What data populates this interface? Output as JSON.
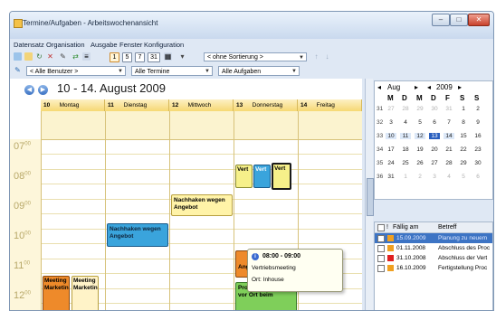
{
  "window": {
    "title": "Termine/Aufgaben - Arbeitswochenansicht",
    "controls": {
      "minimize": "–",
      "maximize": "□",
      "close": "✕"
    }
  },
  "menu": [
    "Datensatz",
    "Organisation",
    "Ausgabe",
    "Fenster",
    "Konfiguration"
  ],
  "toolbar": {
    "view_buttons": [
      "1",
      "5",
      "7",
      "31"
    ],
    "sort_value": "< ohne Sortierung >"
  },
  "filters": {
    "user": "< Alle Benutzer >",
    "appointments": "Alle Termine",
    "tasks": "Alle Aufgaben"
  },
  "calendar": {
    "week_title": "10 - 14. August 2009",
    "days": [
      {
        "num": "10",
        "name": "Montag"
      },
      {
        "num": "11",
        "name": "Dienstag"
      },
      {
        "num": "12",
        "name": "Mittwoch"
      },
      {
        "num": "13",
        "name": "Donnerstag"
      },
      {
        "num": "14",
        "name": "Freitag"
      }
    ],
    "hours": [
      {
        "h": "07",
        "m": "00"
      },
      {
        "h": "08",
        "m": "00"
      },
      {
        "h": "09",
        "m": "00"
      },
      {
        "h": "10",
        "m": "00"
      },
      {
        "h": "11",
        "m": "00"
      },
      {
        "h": "12",
        "m": "00"
      }
    ],
    "appointments": {
      "vert1": "Vert",
      "vert2": "Vert",
      "vert3": "Vert",
      "nachhaken_mi": "Nachhaken wegen Angebot",
      "nachhaken_di": "Nachhaken wegen Angebot",
      "angebot_do": "Angebot",
      "produkt": "Produktpräsentation vor Ort beim",
      "meeting_mo": "Meeting Marketingabel",
      "meeting_mo2": "Meeting Marketingabel"
    },
    "tooltip": {
      "time": "08:00 - 09:00",
      "subject": "Vertriebsmeeting",
      "location": "Ort: Inhouse"
    }
  },
  "mini_calendar": {
    "month": "Aug",
    "year": "2009",
    "weekday_headers": [
      "M",
      "D",
      "M",
      "D",
      "F",
      "S",
      "S"
    ],
    "weeks": [
      {
        "kw": "31",
        "days": [
          "27",
          "28",
          "29",
          "30",
          "31",
          "1",
          "2"
        ]
      },
      {
        "kw": "32",
        "days": [
          "3",
          "4",
          "5",
          "6",
          "7",
          "8",
          "9"
        ]
      },
      {
        "kw": "33",
        "days": [
          "10",
          "11",
          "12",
          "13",
          "14",
          "15",
          "16"
        ]
      },
      {
        "kw": "34",
        "days": [
          "17",
          "18",
          "19",
          "20",
          "21",
          "22",
          "23"
        ]
      },
      {
        "kw": "35",
        "days": [
          "24",
          "25",
          "26",
          "27",
          "28",
          "29",
          "30"
        ]
      },
      {
        "kw": "36",
        "days": [
          "31",
          "1",
          "2",
          "3",
          "4",
          "5",
          "6"
        ]
      }
    ]
  },
  "task_list": {
    "headers": {
      "due": "Fällig am",
      "subject": "Betreff"
    },
    "rows": [
      {
        "due": "15.09.2009",
        "subject": "Planung zu neuem",
        "color": "#f0a020",
        "selected": true
      },
      {
        "due": "01.11.2008",
        "subject": "Abschluss des Proc",
        "color": "#f0a020",
        "selected": false
      },
      {
        "due": "31.10.2008",
        "subject": "Abschluss der Vert",
        "color": "#e02020",
        "selected": false
      },
      {
        "due": "16.10.2009",
        "subject": "Fertigstellung Proc",
        "color": "#f0a020",
        "selected": false
      }
    ]
  },
  "colors": {
    "accent": "#3d74c4",
    "today": "#2a5fbf",
    "appt_yellow": "#f6f08a",
    "appt_blue": "#3aa4dc",
    "appt_green": "#7fcf5a",
    "appt_orange": "#ee8a2a",
    "appt_yellow2": "#fff3a8"
  }
}
